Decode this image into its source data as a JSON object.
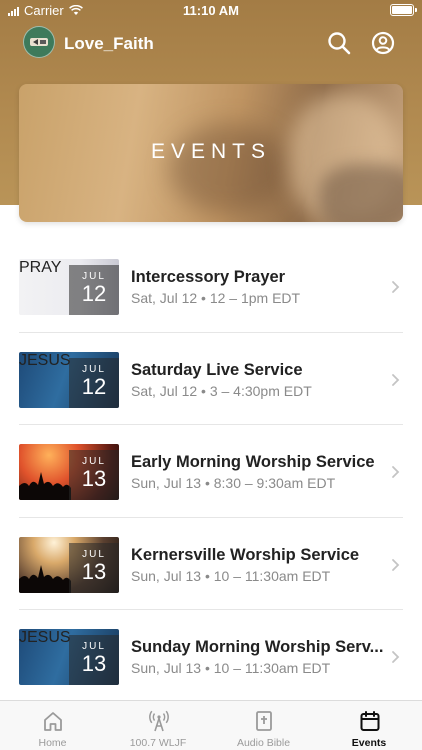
{
  "status_bar": {
    "carrier": "Carrier",
    "time": "11:10 AM"
  },
  "header": {
    "app_name": "Love_Faith",
    "search_icon": "search-icon",
    "profile_icon": "account-circle-icon"
  },
  "banner": {
    "title": "EVENTS"
  },
  "events": [
    {
      "title": "Intercessory Prayer",
      "time": "Sat, Jul 12 • 12 – 1pm EDT",
      "month": "JUL",
      "day": "12",
      "thumb_text": "PRAY",
      "thumb_style": "pray"
    },
    {
      "title": "Saturday Live Service",
      "time": "Sat, Jul 12 • 3 – 4:30pm EDT",
      "month": "JUL",
      "day": "12",
      "thumb_text": "JESUS",
      "thumb_style": "jesus"
    },
    {
      "title": "Early Morning Worship Service",
      "time": "Sun, Jul 13 • 8:30 – 9:30am EDT",
      "month": "JUL",
      "day": "13",
      "thumb_text": "",
      "thumb_style": "concert-orange"
    },
    {
      "title": "Kernersville Worship Service",
      "time": "Sun, Jul 13 • 10 – 11:30am EDT",
      "month": "JUL",
      "day": "13",
      "thumb_text": "",
      "thumb_style": "concert-light"
    },
    {
      "title": "Sunday Morning Worship Serv...",
      "time": "Sun, Jul 13 • 10 – 11:30am EDT",
      "month": "JUL",
      "day": "13",
      "thumb_text": "JESUS",
      "thumb_style": "jesus"
    }
  ],
  "tabs": [
    {
      "label": "Home",
      "icon": "home-icon",
      "active": false
    },
    {
      "label": "100.7 WLJF",
      "icon": "radio-icon",
      "active": false
    },
    {
      "label": "Audio Bible",
      "icon": "bible-icon",
      "active": false
    },
    {
      "label": "Events",
      "icon": "calendar-icon",
      "active": true
    }
  ],
  "colors": {
    "header_gold": "#b18a50",
    "active_tab": "#111111",
    "inactive_tab": "#9a9a9a"
  }
}
